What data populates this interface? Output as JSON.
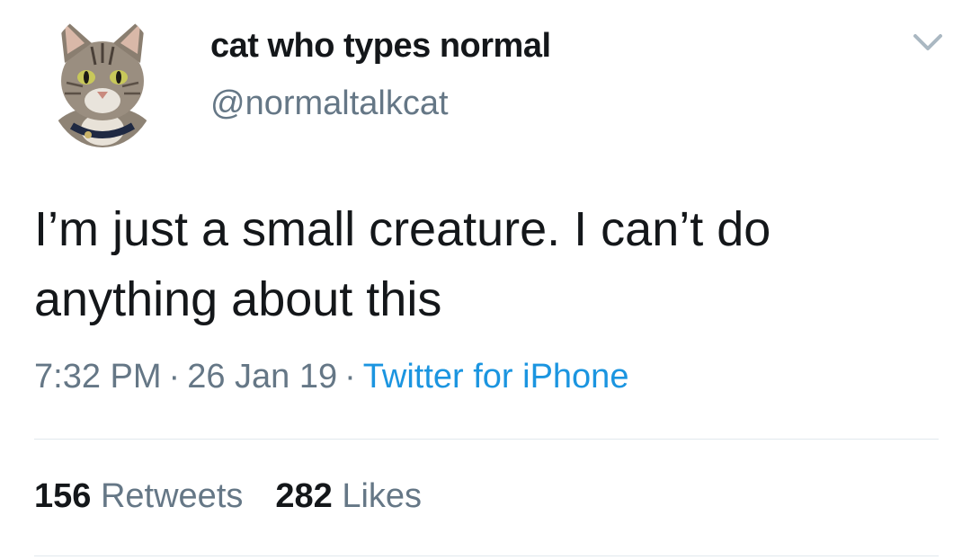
{
  "tweet": {
    "author": {
      "display_name": "cat who types normal",
      "handle": "@normaltalkcat",
      "avatar_icon": "cat-avatar"
    },
    "menu_icon": "chevron-down-icon",
    "text_line1": "I’m just a small creature. I can’t do",
    "text_line2": "anything about this",
    "time": "7:32 PM",
    "date": "26 Jan 19",
    "separator": "·",
    "source": "Twitter for iPhone",
    "retweets_count": "156",
    "retweets_label": "Retweets",
    "likes_count": "282",
    "likes_label": "Likes"
  },
  "colors": {
    "text_primary": "#14171a",
    "text_secondary": "#657786",
    "link": "#1b95e0",
    "divider": "#e1e8ed"
  }
}
